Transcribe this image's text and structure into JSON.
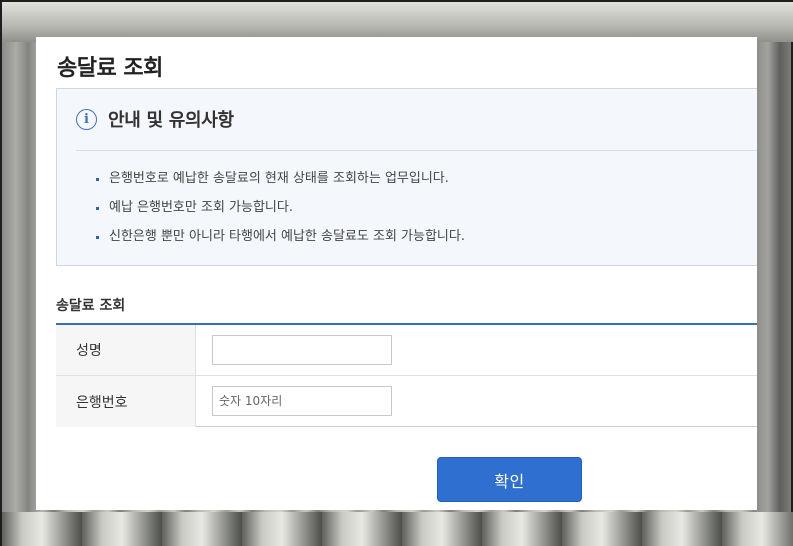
{
  "page": {
    "title": "송달료 조회"
  },
  "notice": {
    "icon": "info-icon",
    "title": "안내 및 유의사항",
    "items": [
      "은행번호로 예납한 송달료의 현재 상태를 조회하는 업무입니다.",
      "예납 은행번호만 조회 가능합니다.",
      "신한은행 뿐만 아니라 타행에서 예납한 송달료도 조회 가능합니다."
    ]
  },
  "form": {
    "section_title": "송달료 조회",
    "name_label": "성명",
    "name_value": "",
    "name_placeholder": "",
    "bank_number_label": "은행번호",
    "bank_number_value": "",
    "bank_number_placeholder": "숫자 10자리"
  },
  "actions": {
    "confirm_label": "확인"
  },
  "colors": {
    "accent": "#2f6fd0",
    "notice_bg": "#f4f7fb",
    "table_top_border": "#3a6db5"
  }
}
